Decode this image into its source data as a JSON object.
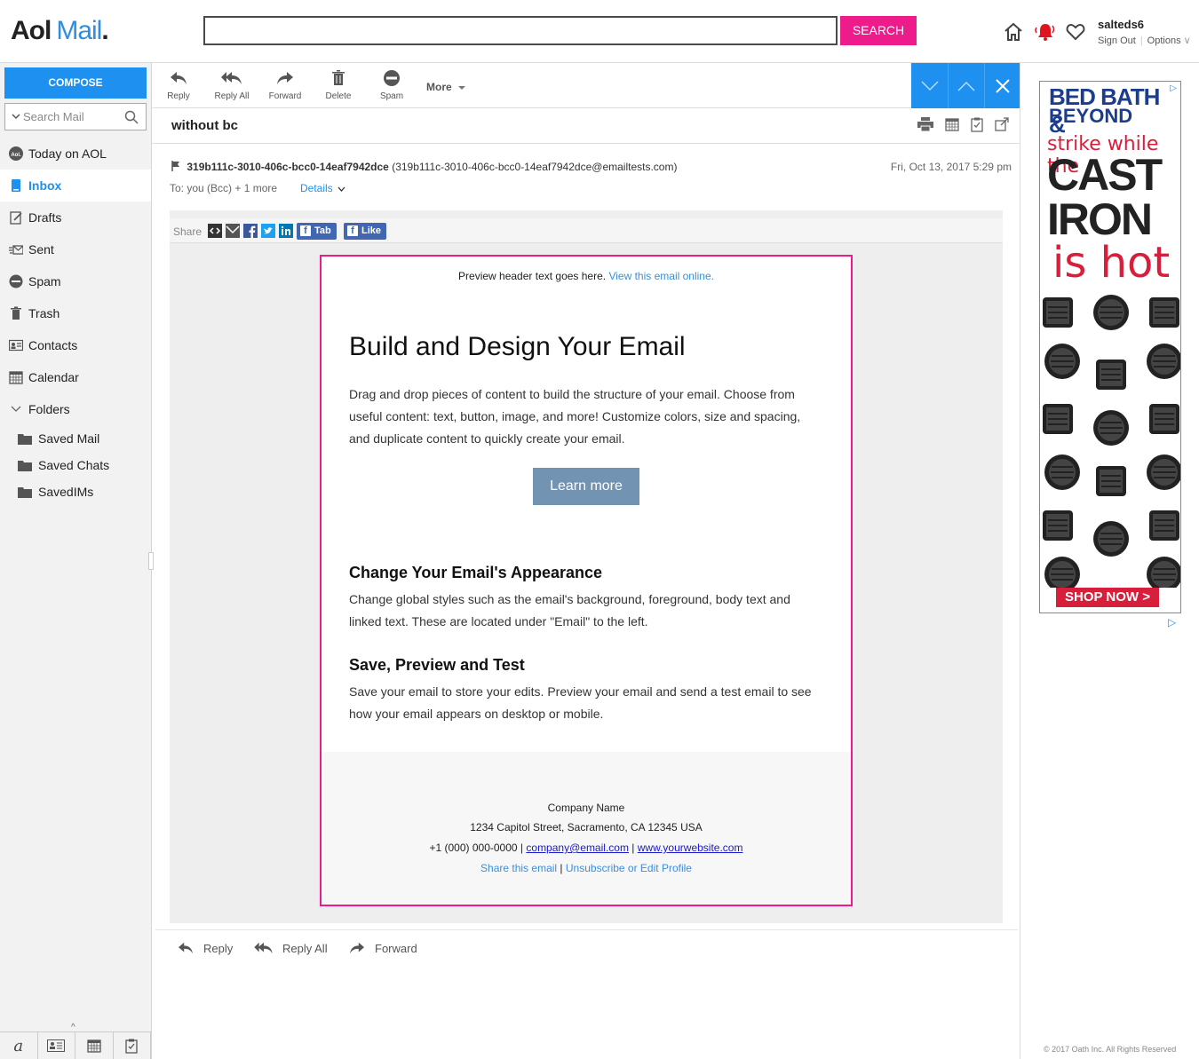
{
  "header": {
    "logo_aol": "Aol",
    "logo_mail": "Mail",
    "logo_dot": ".",
    "search_button": "SEARCH",
    "username": "salteds6",
    "sign_out": "Sign Out",
    "options": "Options"
  },
  "sidebar": {
    "compose": "COMPOSE",
    "search_placeholder": "Search Mail",
    "items": [
      {
        "label": "Today on AOL"
      },
      {
        "label": "Inbox"
      },
      {
        "label": "Drafts"
      },
      {
        "label": "Sent"
      },
      {
        "label": "Spam"
      },
      {
        "label": "Trash"
      },
      {
        "label": "Contacts"
      },
      {
        "label": "Calendar"
      },
      {
        "label": "Folders"
      }
    ],
    "folders": [
      {
        "label": "Saved Mail"
      },
      {
        "label": "Saved Chats"
      },
      {
        "label": "SavedIMs"
      }
    ]
  },
  "toolbar": {
    "reply": "Reply",
    "reply_all": "Reply All",
    "forward": "Forward",
    "delete": "Delete",
    "spam": "Spam",
    "more": "More"
  },
  "message": {
    "subject": "without bc",
    "sender_name": "319b111c-3010-406c-bcc0-14eaf7942dce",
    "sender_email": "(319b111c-3010-406c-bcc0-14eaf7942dce@emailtests.com)",
    "date": "Fri, Oct 13, 2017 5:29 pm",
    "to": "To: you (Bcc) + 1 more",
    "details": "Details"
  },
  "share": {
    "label": "Share",
    "tab": "Tab",
    "like": "Like"
  },
  "email": {
    "preview_text": "Preview header text goes here.",
    "preview_link": "View this email online.",
    "title": "Build and Design Your Email",
    "intro": "Drag and drop pieces of content to build the structure of your email. Choose from useful content: text, button, image, and more! Customize colors, size and spacing, and duplicate content to quickly create your email.",
    "button": "Learn more",
    "h2_1": "Change Your Email's Appearance",
    "p_1": "Change global styles such as the email's background, foreground, body text and linked text. These are located under \"Email\" to the left.",
    "h2_2": "Save, Preview and Test",
    "p_2": "Save your email to store your edits. Preview your email and send a test email to see how your email appears on desktop or mobile.",
    "footer_company": "Company Name",
    "footer_address": "1234 Capitol Street, Sacramento, CA 12345 USA",
    "footer_phone": "+1 (000) 000-0000",
    "footer_sep": "|",
    "footer_email": "company@email.com",
    "footer_site": "www.yourwebsite.com",
    "footer_share": "Share this email",
    "footer_unsub": "Unsubscribe or Edit Profile"
  },
  "reply_bar": {
    "reply": "Reply",
    "reply_all": "Reply All",
    "forward": "Forward"
  },
  "ad": {
    "line1": "BED BATH &",
    "line2": "BEYOND",
    "line3": "strike while the",
    "line4": "CAST",
    "line5": "IRON",
    "line6": "is hot",
    "cta": "SHOP NOW >"
  },
  "footer": {
    "copyright": "© 2017 Oath Inc. All Rights Reserved"
  },
  "colors": {
    "accent": "#1e90f0",
    "search_button": "#ee1c8a",
    "email_border": "#ec1a8c",
    "cta_button": "#7393b3"
  }
}
